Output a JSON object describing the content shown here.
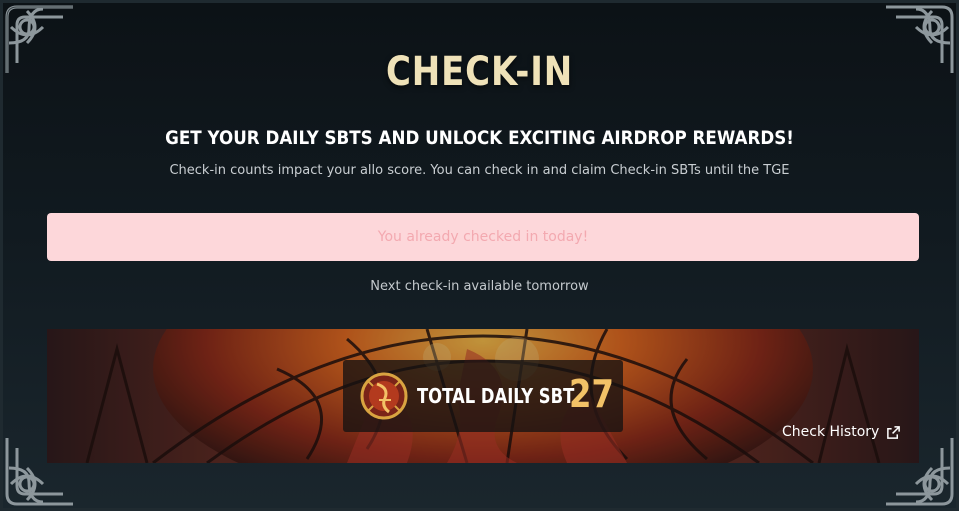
{
  "page": {
    "title": "CHECK-IN",
    "subtitle": "GET YOUR DAILY SBTS AND UNLOCK EXCITING AIRDROP REWARDS!",
    "description": "Check-in counts impact your allo score. You can check in and claim Check-in SBTs until the TGE"
  },
  "checkin": {
    "status_message": "You already checked in today!",
    "next_message": "Next check-in available tomorrow"
  },
  "banner": {
    "label": "TOTAL DAILY SBT",
    "value": "27",
    "history_link": "Check History",
    "history_icon": "external-link-icon",
    "emblem_icon": "dragon-emblem-icon"
  },
  "colors": {
    "title": "#efe2b8",
    "status_bg": "#fdd7da",
    "status_text": "#f3a9b0",
    "sbt_value": "#f3c267"
  }
}
